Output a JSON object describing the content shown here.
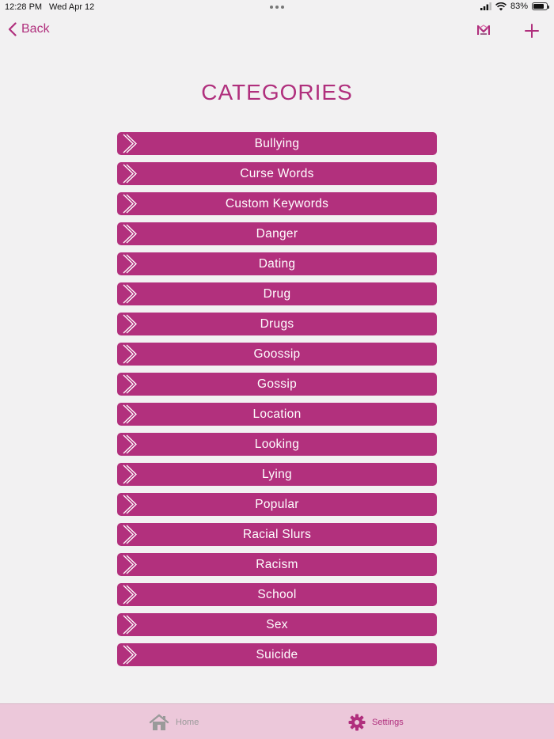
{
  "status_bar": {
    "time": "12:28 PM",
    "date": "Wed Apr 12",
    "battery": "83%",
    "battery_level": 0.83
  },
  "nav": {
    "back_label": "Back"
  },
  "page_title": "CATEGORIES",
  "categories": [
    "Bullying",
    "Curse Words",
    "Custom Keywords",
    "Danger",
    "Dating",
    "Drug",
    "Drugs",
    "Goossip",
    "Gossip",
    "Location",
    "Looking",
    "Lying",
    "Popular",
    "Racial Slurs",
    "Racism",
    "School",
    "Sex",
    "Suicide"
  ],
  "tab_bar": {
    "home_label": "Home",
    "settings_label": "Settings",
    "active_tab": "Settings"
  },
  "colors": {
    "accent": "#b02f7d",
    "button": "#b2307d",
    "tab_bar": "#ecc8da",
    "background": "#f2f1f2"
  }
}
